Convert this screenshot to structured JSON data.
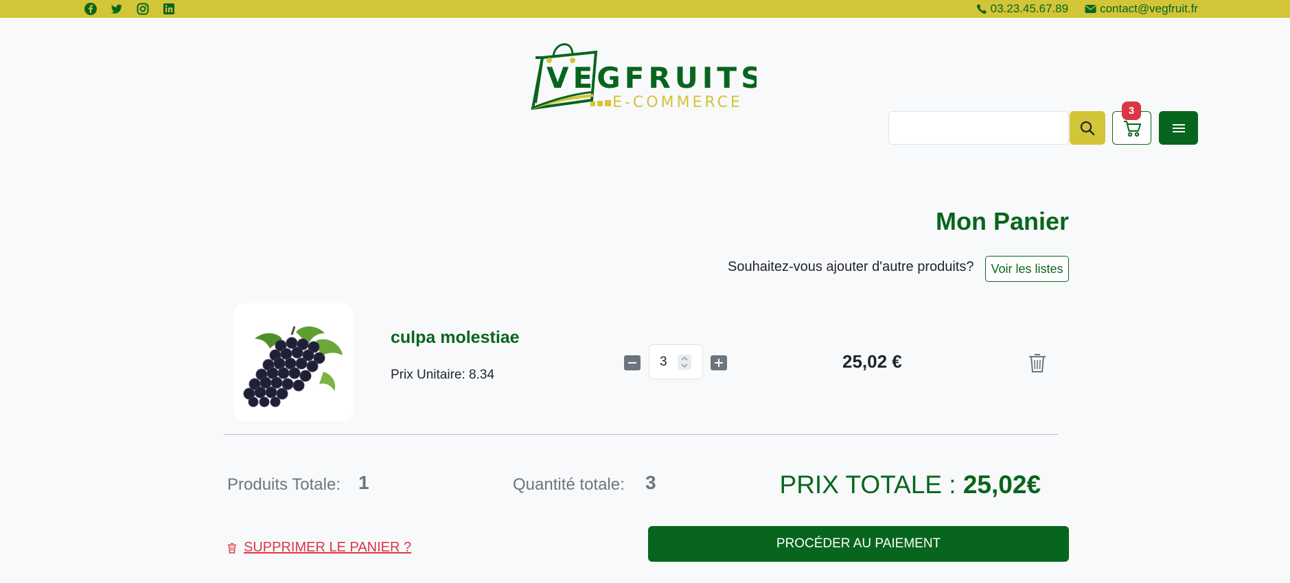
{
  "topbar": {
    "social": [
      "facebook-icon",
      "twitter-icon",
      "instagram-icon",
      "linkedin-icon"
    ],
    "phone": "03.23.45.67.89",
    "email": "contact@vegfruit.fr"
  },
  "logo": {
    "word": "VEGFRUITS",
    "sub": "E-COMMERCE"
  },
  "header": {
    "cart_count": "3"
  },
  "panier": {
    "title": "Mon Panier",
    "ask": "Souhaitez-vous ajouter d'autre produits?",
    "lists_button": "Voir les listes"
  },
  "item": {
    "name": "culpa molestiae",
    "unit_price": "Prix Unitaire: 8.34",
    "quantity": "3",
    "line_total": "25,02 €"
  },
  "summary": {
    "products_label": "Produits Totale:",
    "products_value": "1",
    "qty_label": "Quantité totale:",
    "qty_value": "3",
    "total_label": "PRIX TOTALE :",
    "total_value": "25,02€"
  },
  "actions": {
    "delete": "SUPPRIMER LE PANIER ?",
    "pay": "PROCÉDER AU PAIEMENT"
  },
  "colors": {
    "brand_green": "#08651d",
    "brand_yellow": "#d2c538",
    "danger": "#dc3545"
  }
}
